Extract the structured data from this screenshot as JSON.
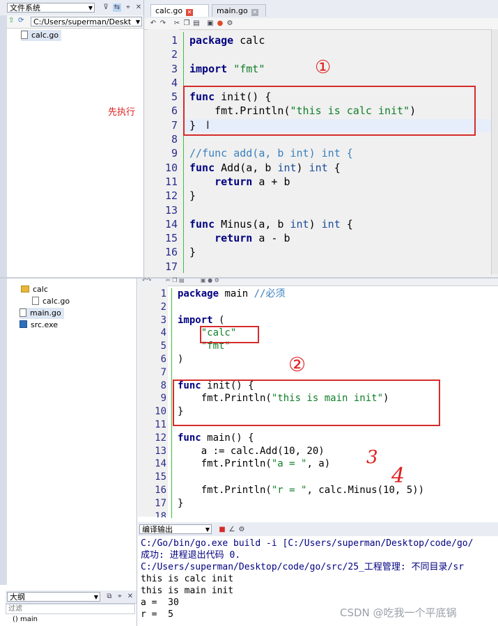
{
  "top": {
    "left_panel": {
      "combo": "文件系统",
      "path": "C:/Users/superman/Deskt",
      "files": [
        "calc.go"
      ]
    },
    "tabs": [
      {
        "label": "calc.go",
        "active": true
      },
      {
        "label": "main.go",
        "active": false
      }
    ],
    "annotation": "先执行",
    "marker": "①",
    "code": [
      [
        [
          "kw",
          "package"
        ],
        [
          "op",
          " calc"
        ]
      ],
      [],
      [
        [
          "kw",
          "import"
        ],
        [
          "op",
          " "
        ],
        [
          "str",
          "\"fmt\""
        ]
      ],
      [],
      [
        [
          "kw",
          "func"
        ],
        [
          "op",
          " init() {"
        ]
      ],
      [
        [
          "op",
          "    fmt.Println("
        ],
        [
          "str",
          "\"this is calc init\""
        ],
        [
          "op",
          ")"
        ]
      ],
      [
        [
          "op",
          "}"
        ]
      ],
      [],
      [
        [
          "cmt",
          "//func add(a, b int) int {"
        ]
      ],
      [
        [
          "kw",
          "func"
        ],
        [
          "op",
          " Add(a, b "
        ],
        [
          "ty",
          "int"
        ],
        [
          "op",
          ") "
        ],
        [
          "ty",
          "int"
        ],
        [
          "op",
          " {"
        ]
      ],
      [
        [
          "kw",
          "    return"
        ],
        [
          "op",
          " a + b"
        ]
      ],
      [
        [
          "op",
          "}"
        ]
      ],
      [],
      [
        [
          "kw",
          "func"
        ],
        [
          "op",
          " Minus(a, b "
        ],
        [
          "ty",
          "int"
        ],
        [
          "op",
          ") "
        ],
        [
          "ty",
          "int"
        ],
        [
          "op",
          " {"
        ]
      ],
      [
        [
          "kw",
          "    return"
        ],
        [
          "op",
          " a - b"
        ]
      ],
      [
        [
          "op",
          "}"
        ]
      ],
      []
    ]
  },
  "bottom": {
    "tree": [
      {
        "label": "calc",
        "kind": "folder"
      },
      {
        "label": "calc.go",
        "kind": "file"
      },
      {
        "label": "main.go",
        "kind": "file"
      },
      {
        "label": "src.exe",
        "kind": "exe"
      }
    ],
    "outline_combo": "大纲",
    "filter_placeholder": "过滤",
    "outline_item": "() main",
    "markers": [
      "②",
      "3",
      "4"
    ],
    "code": [
      [
        [
          "kw",
          "package"
        ],
        [
          "op",
          " main "
        ],
        [
          "cmt",
          "//必须"
        ]
      ],
      [],
      [
        [
          "kw",
          "import"
        ],
        [
          "op",
          " ("
        ]
      ],
      [
        [
          "str",
          "    \"calc\""
        ]
      ],
      [
        [
          "str",
          "    \"fmt\""
        ]
      ],
      [
        [
          "op",
          ")"
        ]
      ],
      [],
      [
        [
          "kw",
          "func"
        ],
        [
          "op",
          " init() {"
        ]
      ],
      [
        [
          "op",
          "    fmt.Println("
        ],
        [
          "str",
          "\"this is main init\""
        ],
        [
          "op",
          ")"
        ]
      ],
      [
        [
          "op",
          "}"
        ]
      ],
      [],
      [
        [
          "kw",
          "func"
        ],
        [
          "op",
          " main() {"
        ]
      ],
      [
        [
          "op",
          "    a := calc.Add(10, 20)"
        ]
      ],
      [
        [
          "op",
          "    fmt.Println("
        ],
        [
          "str",
          "\"a = \""
        ],
        [
          "op",
          ", a)"
        ]
      ],
      [],
      [
        [
          "op",
          "    fmt.Println("
        ],
        [
          "str",
          "\"r = \""
        ],
        [
          "op",
          ", calc.Minus(10, 5))"
        ]
      ],
      [
        [
          "op",
          "}"
        ]
      ],
      []
    ],
    "output_combo": "编译输出",
    "output_lines": [
      "C:/Go/bin/go.exe build -i [C:/Users/superman/Desktop/code/go/",
      "成功: 进程退出代码 0.",
      "C:/Users/superman/Desktop/code/go/src/25_工程管理: 不同目录/sr",
      "this is calc init",
      "this is main init",
      "a =  30",
      "r =  5"
    ],
    "watermark": "CSDN @吃我一个平底锅"
  },
  "colors": {
    "accent_red": "#d62b2b",
    "keyword": "#000080",
    "string": "#0f7f28",
    "comment": "#3a7fbd"
  }
}
